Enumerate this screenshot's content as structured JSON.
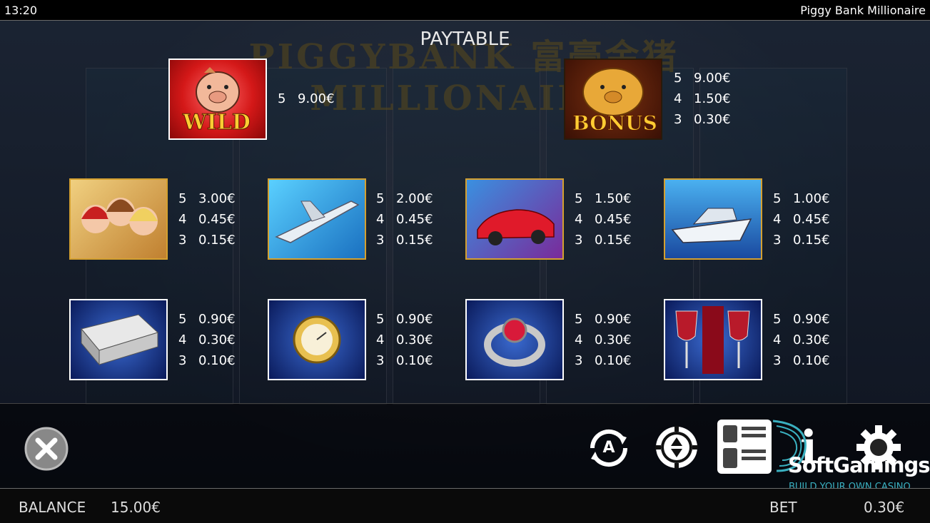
{
  "status_bar": {
    "time": "13:20",
    "game_title": "Piggy Bank Millionaire"
  },
  "background_title": "PIGGYBANK 富豪金猪 MILLIONAIRE",
  "paytable_title": "PAYTABLE",
  "symbols": {
    "wild": {
      "label": "WILD",
      "pays": [
        {
          "count": "5",
          "amount": "9.00€"
        }
      ]
    },
    "bonus": {
      "label": "BONUS",
      "pays": [
        {
          "count": "5",
          "amount": "9.00€"
        },
        {
          "count": "4",
          "amount": "1.50€"
        },
        {
          "count": "3",
          "amount": "0.30€"
        }
      ]
    },
    "girls": {
      "pays": [
        {
          "count": "5",
          "amount": "3.00€"
        },
        {
          "count": "4",
          "amount": "0.45€"
        },
        {
          "count": "3",
          "amount": "0.15€"
        }
      ]
    },
    "jet": {
      "pays": [
        {
          "count": "5",
          "amount": "2.00€"
        },
        {
          "count": "4",
          "amount": "0.45€"
        },
        {
          "count": "3",
          "amount": "0.15€"
        }
      ]
    },
    "car": {
      "pays": [
        {
          "count": "5",
          "amount": "1.50€"
        },
        {
          "count": "4",
          "amount": "0.45€"
        },
        {
          "count": "3",
          "amount": "0.15€"
        }
      ]
    },
    "yacht": {
      "pays": [
        {
          "count": "5",
          "amount": "1.00€"
        },
        {
          "count": "4",
          "amount": "0.45€"
        },
        {
          "count": "3",
          "amount": "0.15€"
        }
      ]
    },
    "briefcase": {
      "pays": [
        {
          "count": "5",
          "amount": "0.90€"
        },
        {
          "count": "4",
          "amount": "0.30€"
        },
        {
          "count": "3",
          "amount": "0.10€"
        }
      ]
    },
    "watch": {
      "pays": [
        {
          "count": "5",
          "amount": "0.90€"
        },
        {
          "count": "4",
          "amount": "0.30€"
        },
        {
          "count": "3",
          "amount": "0.10€"
        }
      ]
    },
    "ring": {
      "pays": [
        {
          "count": "5",
          "amount": "0.90€"
        },
        {
          "count": "4",
          "amount": "0.30€"
        },
        {
          "count": "3",
          "amount": "0.10€"
        }
      ]
    },
    "wine": {
      "pays": [
        {
          "count": "5",
          "amount": "0.90€"
        },
        {
          "count": "4",
          "amount": "0.30€"
        },
        {
          "count": "3",
          "amount": "0.10€"
        }
      ]
    }
  },
  "controls": {
    "autoplay_letter": "A",
    "info_letter": "i"
  },
  "footer": {
    "balance_label": "BALANCE",
    "balance_value": "15.00€",
    "bet_label": "BET",
    "bet_value": "0.30€"
  },
  "watermark": {
    "brand": "SoftGamings",
    "tagline": "BUILD YOUR OWN CASINO"
  },
  "colors": {
    "accent": "#e8c050",
    "panel": "#000000",
    "text": "#ffffff"
  }
}
